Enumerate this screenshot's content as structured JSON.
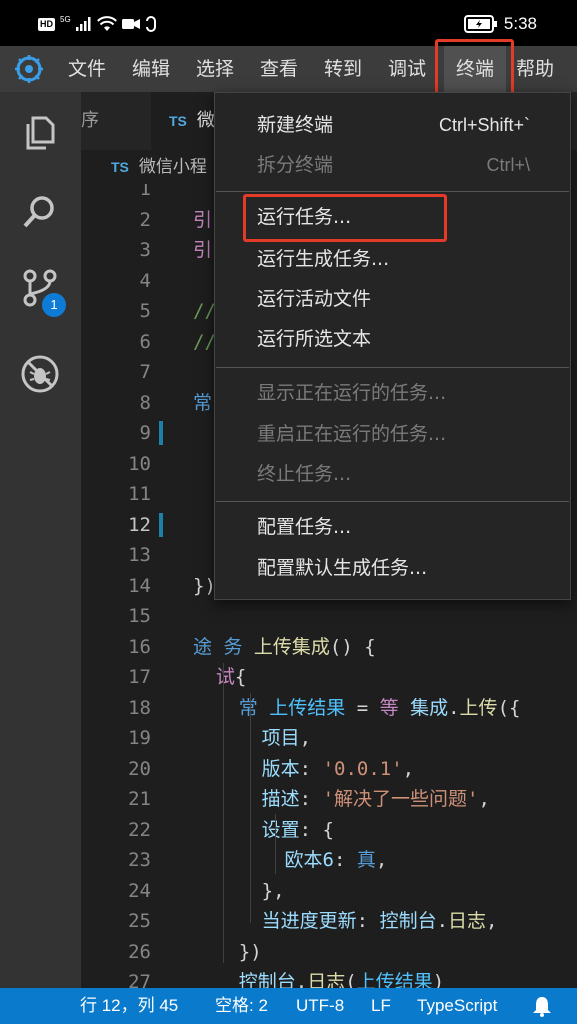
{
  "status_bar": {
    "hd": "HD",
    "signal": "5G",
    "time": "5:38"
  },
  "menu": [
    "文件",
    "编辑",
    "选择",
    "查看",
    "转到",
    "调试",
    "终端",
    "帮助"
  ],
  "activity": {
    "badge": "1"
  },
  "tabs": {
    "partial_left": "序",
    "ts_label": "TS",
    "active_partial": "微"
  },
  "breadcrumb": {
    "ts_label": "TS",
    "text": "微信小程"
  },
  "editor": {
    "lines": [
      {
        "num": "1",
        "html": ""
      },
      {
        "num": "2",
        "html": "<span class=\"kw2\">引</span>"
      },
      {
        "num": "3",
        "html": "<span class=\"kw2\">引</span>"
      },
      {
        "num": "4",
        "html": ""
      },
      {
        "num": "5",
        "html": "<span class=\"cmt\">//</span>"
      },
      {
        "num": "6",
        "html": "<span class=\"cmt\">//</span>"
      },
      {
        "num": "7",
        "html": ""
      },
      {
        "num": "8",
        "html": "<span class=\"kw\">常</span>"
      },
      {
        "num": "9",
        "html": ""
      },
      {
        "num": "10",
        "html": ""
      },
      {
        "num": "11",
        "html": ""
      },
      {
        "num": "12",
        "html": ""
      },
      {
        "num": "13",
        "html": ""
      },
      {
        "num": "14",
        "html": "<span class=\"pun\">})</span>"
      },
      {
        "num": "15",
        "html": ""
      },
      {
        "num": "16",
        "html": "<span class=\"kw\">途 务</span> <span class=\"fn\">上传集成</span><span class=\"pun\">() {</span>"
      },
      {
        "num": "17",
        "html": "  <span class=\"kw2\">试</span><span class=\"pun\">{</span>"
      },
      {
        "num": "18",
        "html": "    <span class=\"kw\">常</span> <span class=\"var\">上传结果</span> <span class=\"pun\">=</span> <span class=\"kw2\">等</span> <span class=\"prop\">集成</span><span class=\"pun\">.</span><span class=\"fn\">上传</span><span class=\"pun\">({</span>"
      },
      {
        "num": "19",
        "html": "      <span class=\"prop\">项目</span><span class=\"pun\">,</span>"
      },
      {
        "num": "20",
        "html": "      <span class=\"prop\">版本</span><span class=\"pun\">:</span> <span class=\"str\">'0.0.1'</span><span class=\"pun\">,</span>"
      },
      {
        "num": "21",
        "html": "      <span class=\"prop\">描述</span><span class=\"pun\">:</span> <span class=\"str\">'解决了一些问题'</span><span class=\"pun\">,</span>"
      },
      {
        "num": "22",
        "html": "      <span class=\"prop\">设置</span><span class=\"pun\">: {</span>"
      },
      {
        "num": "23",
        "html": "        <span class=\"prop\">欧本6</span><span class=\"pun\">:</span> <span class=\"kw\">真</span><span class=\"pun\">,</span>"
      },
      {
        "num": "24",
        "html": "      <span class=\"pun\">},</span>"
      },
      {
        "num": "25",
        "html": "      <span class=\"prop\">当进度更新</span><span class=\"pun\">:</span> <span class=\"prop\">控制台</span><span class=\"pun\">.</span><span class=\"fn\">日志</span><span class=\"pun\">,</span>"
      },
      {
        "num": "26",
        "html": "    <span class=\"pun\">})</span>"
      },
      {
        "num": "27",
        "html": "    <span class=\"prop\">控制台</span><span class=\"pun\">.</span><span class=\"fn\">日志</span><span class=\"pun\">(</span><span class=\"var\">上传结果</span><span class=\"pun\">)</span>"
      }
    ]
  },
  "dropdown": {
    "items": [
      {
        "label": "新建终端",
        "shortcut": "Ctrl+Shift+`",
        "disabled": false
      },
      {
        "label": "拆分终端",
        "shortcut": "Ctrl+\\",
        "disabled": true
      },
      {
        "label": "运行任务...",
        "shortcut": "",
        "disabled": false
      },
      {
        "label": "运行生成任务...",
        "shortcut": "",
        "disabled": false
      },
      {
        "label": "运行活动文件",
        "shortcut": "",
        "disabled": false
      },
      {
        "label": "运行所选文本",
        "shortcut": "",
        "disabled": false
      },
      {
        "label": "显示正在运行的任务...",
        "shortcut": "",
        "disabled": true
      },
      {
        "label": "重启正在运行的任务...",
        "shortcut": "",
        "disabled": true
      },
      {
        "label": "终止任务...",
        "shortcut": "",
        "disabled": true
      },
      {
        "label": "配置任务...",
        "shortcut": "",
        "disabled": false
      },
      {
        "label": "配置默认生成任务...",
        "shortcut": "",
        "disabled": false
      }
    ]
  },
  "bottom": {
    "position": "行 12，列 45",
    "spaces": "空格: 2",
    "encoding": "UTF-8",
    "eol": "LF",
    "language": "TypeScript"
  },
  "colors": {
    "highlight": "#e43b28",
    "statusbar": "#0a7acc",
    "menubar": "#3c3c3c"
  }
}
